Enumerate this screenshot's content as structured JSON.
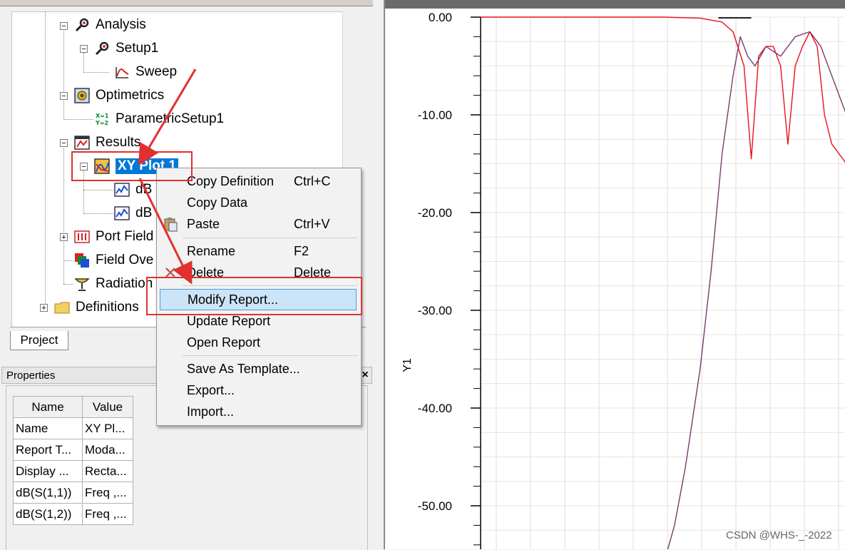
{
  "tree": {
    "analysis": "Analysis",
    "setup": "Setup1",
    "sweep": "Sweep",
    "optimetrics": "Optimetrics",
    "parametric": "ParametricSetup1",
    "results": "Results",
    "xy_plot": "XY Plot 1",
    "trace1": "dB",
    "trace2": "dB",
    "port_field": "Port Field",
    "field_overlays": "Field Ove",
    "radiation": "Radiation",
    "definitions": "Definitions",
    "icons": {
      "analysis": "analysis-icon",
      "setup": "setup-icon",
      "sweep": "sweep-icon",
      "optimetrics": "optimetrics-icon",
      "parametric": "parametric-icon",
      "results": "results-icon",
      "xy_plot": "xy-plot-icon",
      "trace": "trace-icon",
      "port_field": "port-field-icon",
      "field_overlays": "field-overlays-icon",
      "radiation": "radiation-icon",
      "definitions": "folder-icon"
    }
  },
  "tabs": {
    "project": "Project"
  },
  "properties": {
    "title": "Properties",
    "close": "×",
    "columns": [
      "Name",
      "Value"
    ],
    "rows": [
      [
        "Name",
        "XY Pl..."
      ],
      [
        "Report T...",
        "Moda..."
      ],
      [
        "Display ...",
        "Recta..."
      ],
      [
        "dB(S(1,1))",
        "Freq ,..."
      ],
      [
        "dB(S(1,2))",
        "Freq ,..."
      ]
    ]
  },
  "context_menu": {
    "items": [
      {
        "label": "Copy Definition",
        "shortcut": "Ctrl+C"
      },
      {
        "label": "Copy Data",
        "shortcut": ""
      },
      {
        "label": "Paste",
        "shortcut": "Ctrl+V"
      },
      {
        "label": "Rename",
        "shortcut": "F2"
      },
      {
        "label": "Delete",
        "shortcut": "Delete"
      },
      {
        "label": "Modify Report...",
        "shortcut": ""
      },
      {
        "label": "Update Report",
        "shortcut": ""
      },
      {
        "label": "Open Report",
        "shortcut": ""
      },
      {
        "label": "Save As Template...",
        "shortcut": ""
      },
      {
        "label": "Export...",
        "shortcut": ""
      },
      {
        "label": "Import...",
        "shortcut": ""
      }
    ],
    "highlighted": "Modify Report..."
  },
  "colors": {
    "selection": "#0078d7",
    "menu_highlight": "#cce4f7",
    "annotation_red": "#e03030",
    "trace_red": "#e8101a",
    "trace_purple": "#7a3a6a"
  },
  "chart_data": {
    "type": "line",
    "title": "",
    "xlabel": "",
    "ylabel": "Y1",
    "y_ticks": [
      "0.00",
      "-10.00",
      "-20.00",
      "-30.00",
      "-40.00",
      "-50.00"
    ],
    "ylim": [
      -54,
      0
    ],
    "grid": true,
    "series": [
      {
        "color": "#e8101a",
        "x": [
          0,
          0.4,
          0.5,
          0.6,
          0.66,
          0.69,
          0.72,
          0.74,
          0.76,
          0.78,
          0.8,
          0.82,
          0.84,
          0.86,
          0.88,
          0.9,
          0.92,
          0.94,
          0.96,
          1.0
        ],
        "y": [
          0,
          0,
          0,
          -0.1,
          -0.5,
          -1.5,
          -5,
          -14.5,
          -4,
          -3,
          -3,
          -5,
          -13,
          -5,
          -3,
          -1.5,
          -3,
          -10,
          -13,
          -15
        ]
      },
      {
        "color": "#7a3a6a",
        "x": [
          0.5,
          0.53,
          0.56,
          0.6,
          0.63,
          0.66,
          0.69,
          0.71,
          0.73,
          0.75,
          0.78,
          0.82,
          0.86,
          0.9,
          0.93,
          0.96,
          1.0
        ],
        "y": [
          -56,
          -52,
          -46,
          -36,
          -26,
          -14,
          -6,
          -2,
          -4,
          -5,
          -3,
          -4,
          -2,
          -1.5,
          -3,
          -6,
          -10
        ]
      }
    ]
  },
  "watermark": "CSDN @WHS-_-2022"
}
